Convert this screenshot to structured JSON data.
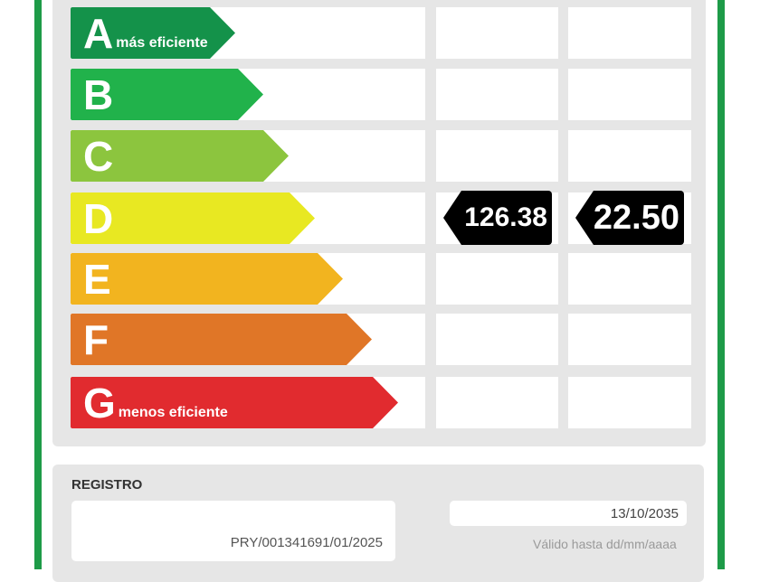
{
  "colors": {
    "frame_green": "#1e9b48",
    "grade_A": "#14924a",
    "grade_B": "#21b24b",
    "grade_C": "#8cc53e",
    "grade_D": "#e8e822",
    "grade_E": "#f2b41f",
    "grade_F": "#e07627",
    "grade_G": "#e12b2f"
  },
  "grades": [
    {
      "letter": "A",
      "subtitle": "más eficiente"
    },
    {
      "letter": "B",
      "subtitle": ""
    },
    {
      "letter": "C",
      "subtitle": ""
    },
    {
      "letter": "D",
      "subtitle": ""
    },
    {
      "letter": "E",
      "subtitle": ""
    },
    {
      "letter": "F",
      "subtitle": ""
    },
    {
      "letter": "G",
      "subtitle": "menos eficiente"
    }
  ],
  "indicators": {
    "row_letter": "D",
    "value_1": "126.38",
    "value_2": "22.50"
  },
  "registro": {
    "label": "REGISTRO",
    "number": "PRY/001341691/01/2025",
    "valid_until": "13/10/2035",
    "valid_hint": "Válido hasta dd/mm/aaaa"
  }
}
